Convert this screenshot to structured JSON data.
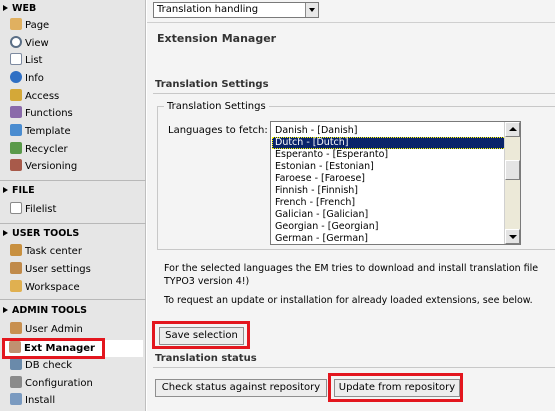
{
  "sidebar": {
    "sections": [
      {
        "label": "WEB",
        "items": [
          {
            "label": "Page",
            "icon": "page-icon",
            "color": "#c58b2e"
          },
          {
            "label": "View",
            "icon": "eye-icon",
            "color": "#5a6e86"
          },
          {
            "label": "List",
            "icon": "list-icon",
            "color": "#7d8aa0"
          },
          {
            "label": "Info",
            "icon": "info-icon",
            "color": "#2f6fc4"
          },
          {
            "label": "Access",
            "icon": "key-icon",
            "color": "#c99a2e"
          },
          {
            "label": "Functions",
            "icon": "wand-icon",
            "color": "#7a5a9a"
          },
          {
            "label": "Template",
            "icon": "template-icon",
            "color": "#3a7cc0"
          },
          {
            "label": "Recycler",
            "icon": "recycle-icon",
            "color": "#4a8a3a"
          },
          {
            "label": "Versioning",
            "icon": "versioning-icon",
            "color": "#9a4a3a"
          }
        ]
      },
      {
        "label": "FILE",
        "items": [
          {
            "label": "Filelist",
            "icon": "filelist-icon",
            "color": "#8a8a8a"
          }
        ]
      },
      {
        "label": "USER TOOLS",
        "items": [
          {
            "label": "Task center",
            "icon": "task-icon",
            "color": "#c08a30"
          },
          {
            "label": "User settings",
            "icon": "user-settings-icon",
            "color": "#b07a3a"
          },
          {
            "label": "Workspace",
            "icon": "workspace-icon",
            "color": "#d0a040"
          }
        ]
      },
      {
        "label": "ADMIN TOOLS",
        "items": [
          {
            "label": "User Admin",
            "icon": "user-admin-icon",
            "color": "#c08a40"
          },
          {
            "label": "Ext Manager",
            "icon": "ext-manager-icon",
            "color": "#b08060"
          },
          {
            "label": "DB check",
            "icon": "db-icon",
            "color": "#5a7a9a"
          },
          {
            "label": "Configuration",
            "icon": "configuration-icon",
            "color": "#7a7a7a"
          },
          {
            "label": "Install",
            "icon": "install-icon",
            "color": "#6a8ab0"
          }
        ]
      }
    ]
  },
  "main": {
    "function_select": "Translation handling",
    "title": "Extension Manager",
    "section_title": "Translation Settings",
    "fieldset_legend": "Translation Settings",
    "languages_label": "Languages to fetch:",
    "languages": [
      {
        "label": "Danish - [Danish]",
        "selected": false
      },
      {
        "label": "Dutch - [Dutch]",
        "selected": true
      },
      {
        "label": "Esperanto - [Esperanto]",
        "selected": false
      },
      {
        "label": "Estonian - [Estonian]",
        "selected": false
      },
      {
        "label": "Faroese - [Faroese]",
        "selected": false
      },
      {
        "label": "Finnish - [Finnish]",
        "selected": false
      },
      {
        "label": "French - [French]",
        "selected": false
      },
      {
        "label": "Galician - [Galician]",
        "selected": false
      },
      {
        "label": "Georgian - [Georgian]",
        "selected": false
      },
      {
        "label": "German - [German]",
        "selected": false
      }
    ],
    "info_line1": "For the selected languages the EM tries to download and install translation file",
    "info_line2": "TYPO3 version 4!)",
    "info_line3": "To request an update or installation for already loaded extensions, see below.",
    "save_button": "Save selection",
    "status_title": "Translation status",
    "check_button": "Check status against repository",
    "update_button": "Update from repository",
    "highlight_color": "#e3161e",
    "selection_color": "#0a246a"
  }
}
